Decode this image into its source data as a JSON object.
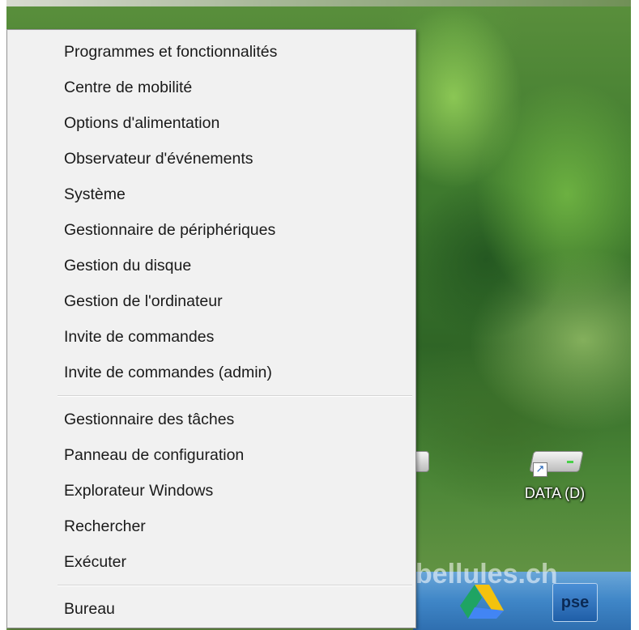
{
  "menu": {
    "groups": [
      {
        "items": [
          {
            "label": "Programmes et fonctionnalités"
          },
          {
            "label": "Centre de mobilité"
          },
          {
            "label": "Options d'alimentation"
          },
          {
            "label": "Observateur d'événements"
          },
          {
            "label": "Système"
          },
          {
            "label": "Gestionnaire de périphériques"
          },
          {
            "label": "Gestion du disque"
          },
          {
            "label": "Gestion de l'ordinateur"
          },
          {
            "label": "Invite de commandes"
          },
          {
            "label": "Invite de commandes (admin)"
          }
        ]
      },
      {
        "items": [
          {
            "label": "Gestionnaire des tâches"
          },
          {
            "label": "Panneau de configuration"
          },
          {
            "label": "Explorateur Windows"
          },
          {
            "label": "Rechercher"
          },
          {
            "label": "Exécuter"
          }
        ]
      },
      {
        "items": [
          {
            "label": "Bureau"
          }
        ]
      }
    ]
  },
  "desktop": {
    "icons": [
      {
        "label": "DATA (D)",
        "icon": "drive-shortcut-icon"
      },
      {
        "label": ")",
        "icon": "drive-shortcut-icon"
      }
    ]
  },
  "taskbar": {
    "apps": [
      {
        "icon": "google-drive-icon"
      },
      {
        "label": "pse",
        "icon": "pse-app-icon"
      }
    ]
  },
  "watermark": "libellules.ch",
  "colors": {
    "menu_background": "#f1f1f1",
    "menu_border": "#979797",
    "taskbar": "#3f86c7"
  }
}
